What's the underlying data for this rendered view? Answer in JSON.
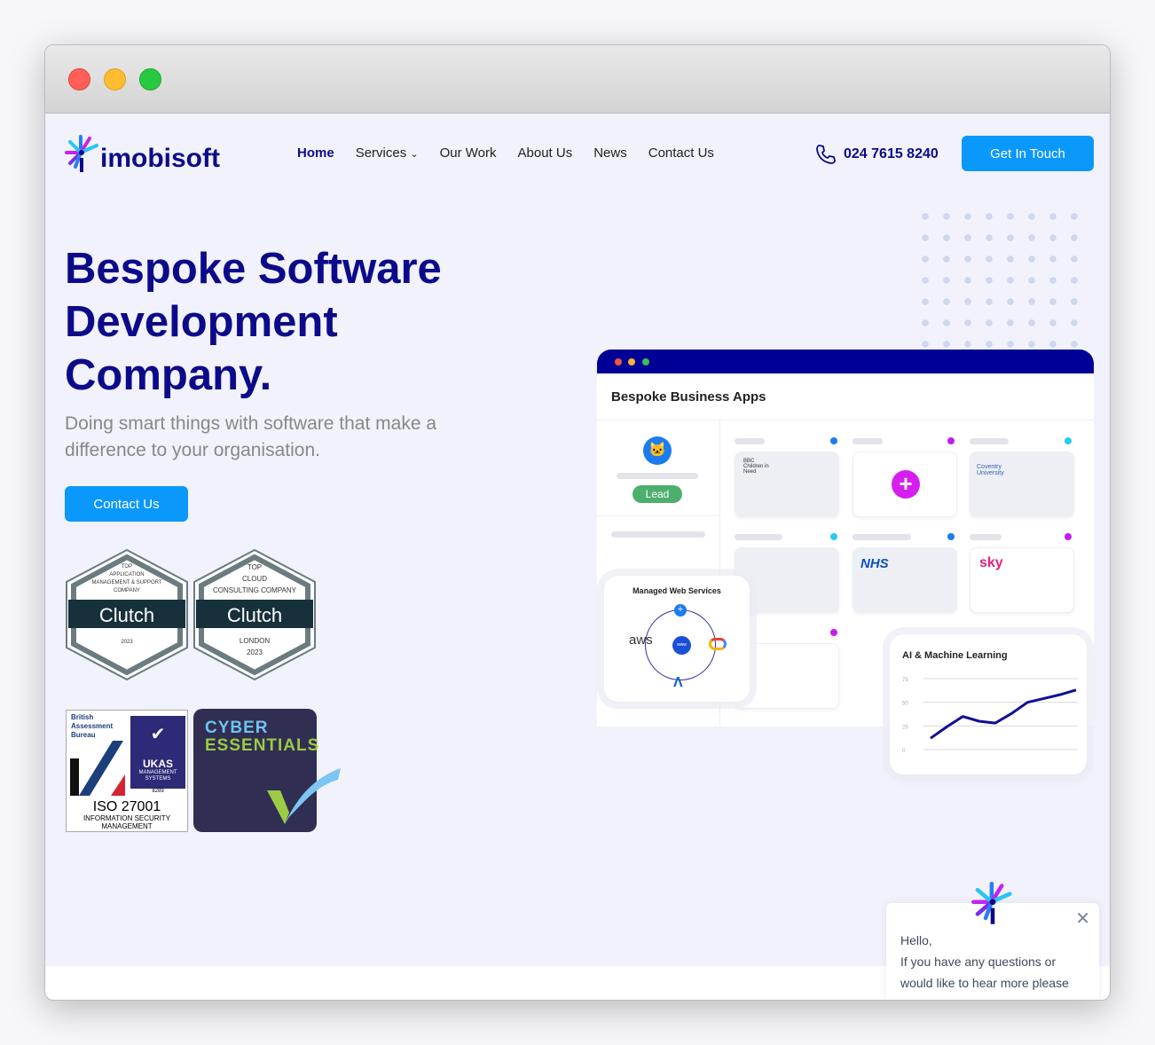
{
  "window": {
    "controls": [
      "close",
      "minimize",
      "maximize"
    ]
  },
  "header": {
    "logo": "imobisoft",
    "nav": [
      {
        "label": "Home",
        "active": true
      },
      {
        "label": "Services",
        "dropdown": true
      },
      {
        "label": "Our Work"
      },
      {
        "label": "About Us"
      },
      {
        "label": "News"
      },
      {
        "label": "Contact Us"
      }
    ],
    "phone": "024 7615 8240",
    "cta": "Get In Touch"
  },
  "hero": {
    "title": "Bespoke Software Development Company.",
    "subtitle": "Doing smart things with software that make a difference to your organisation.",
    "cta": "Contact Us"
  },
  "badges": {
    "clutch1": {
      "top": "TOP",
      "line1": "APPLICATION",
      "line2": "MANAGEMENT & SUPPORT",
      "line3": "COMPANY",
      "brand": "Clutch",
      "year": "2023"
    },
    "clutch2": {
      "top": "TOP",
      "line1": "CLOUD",
      "line2": "CONSULTING COMPANY",
      "brand": "Clutch",
      "city": "LONDON",
      "year": "2023"
    },
    "iso": {
      "bab": "British Assessment Bureau",
      "ukas": "UKAS",
      "ukas_sub": "MANAGEMENT SYSTEMS",
      "num": "8289",
      "iso": "ISO 27001",
      "iso_sub": "INFORMATION SECURITY MANAGEMENT"
    },
    "cyber": {
      "line1": "CYBER",
      "line2": "ESSENTIALS"
    }
  },
  "mockup": {
    "title": "Bespoke Business Apps",
    "lead": "Lead",
    "logos": {
      "bbc": "BBC Children in Need",
      "coventry": "Coventry University",
      "nhs": "NHS",
      "sky": "sky"
    },
    "web": {
      "title": "Managed Web Services",
      "aws": "aws",
      "www": "www"
    },
    "ai": {
      "title": "AI & Machine Learning",
      "chart_data": {
        "type": "line",
        "yticks": [
          0,
          25,
          50,
          75
        ],
        "ylim": [
          0,
          75
        ],
        "values": [
          12,
          24,
          35,
          30,
          28,
          38,
          50,
          54,
          58,
          63
        ]
      }
    },
    "colors": {
      "bar": "#010096",
      "accent": "#0b98fb",
      "plus": "#d61ef0"
    }
  },
  "chat": {
    "greeting": "Hello,",
    "message": "If you have any questions or would like to hear more please feel free to leave your details"
  }
}
